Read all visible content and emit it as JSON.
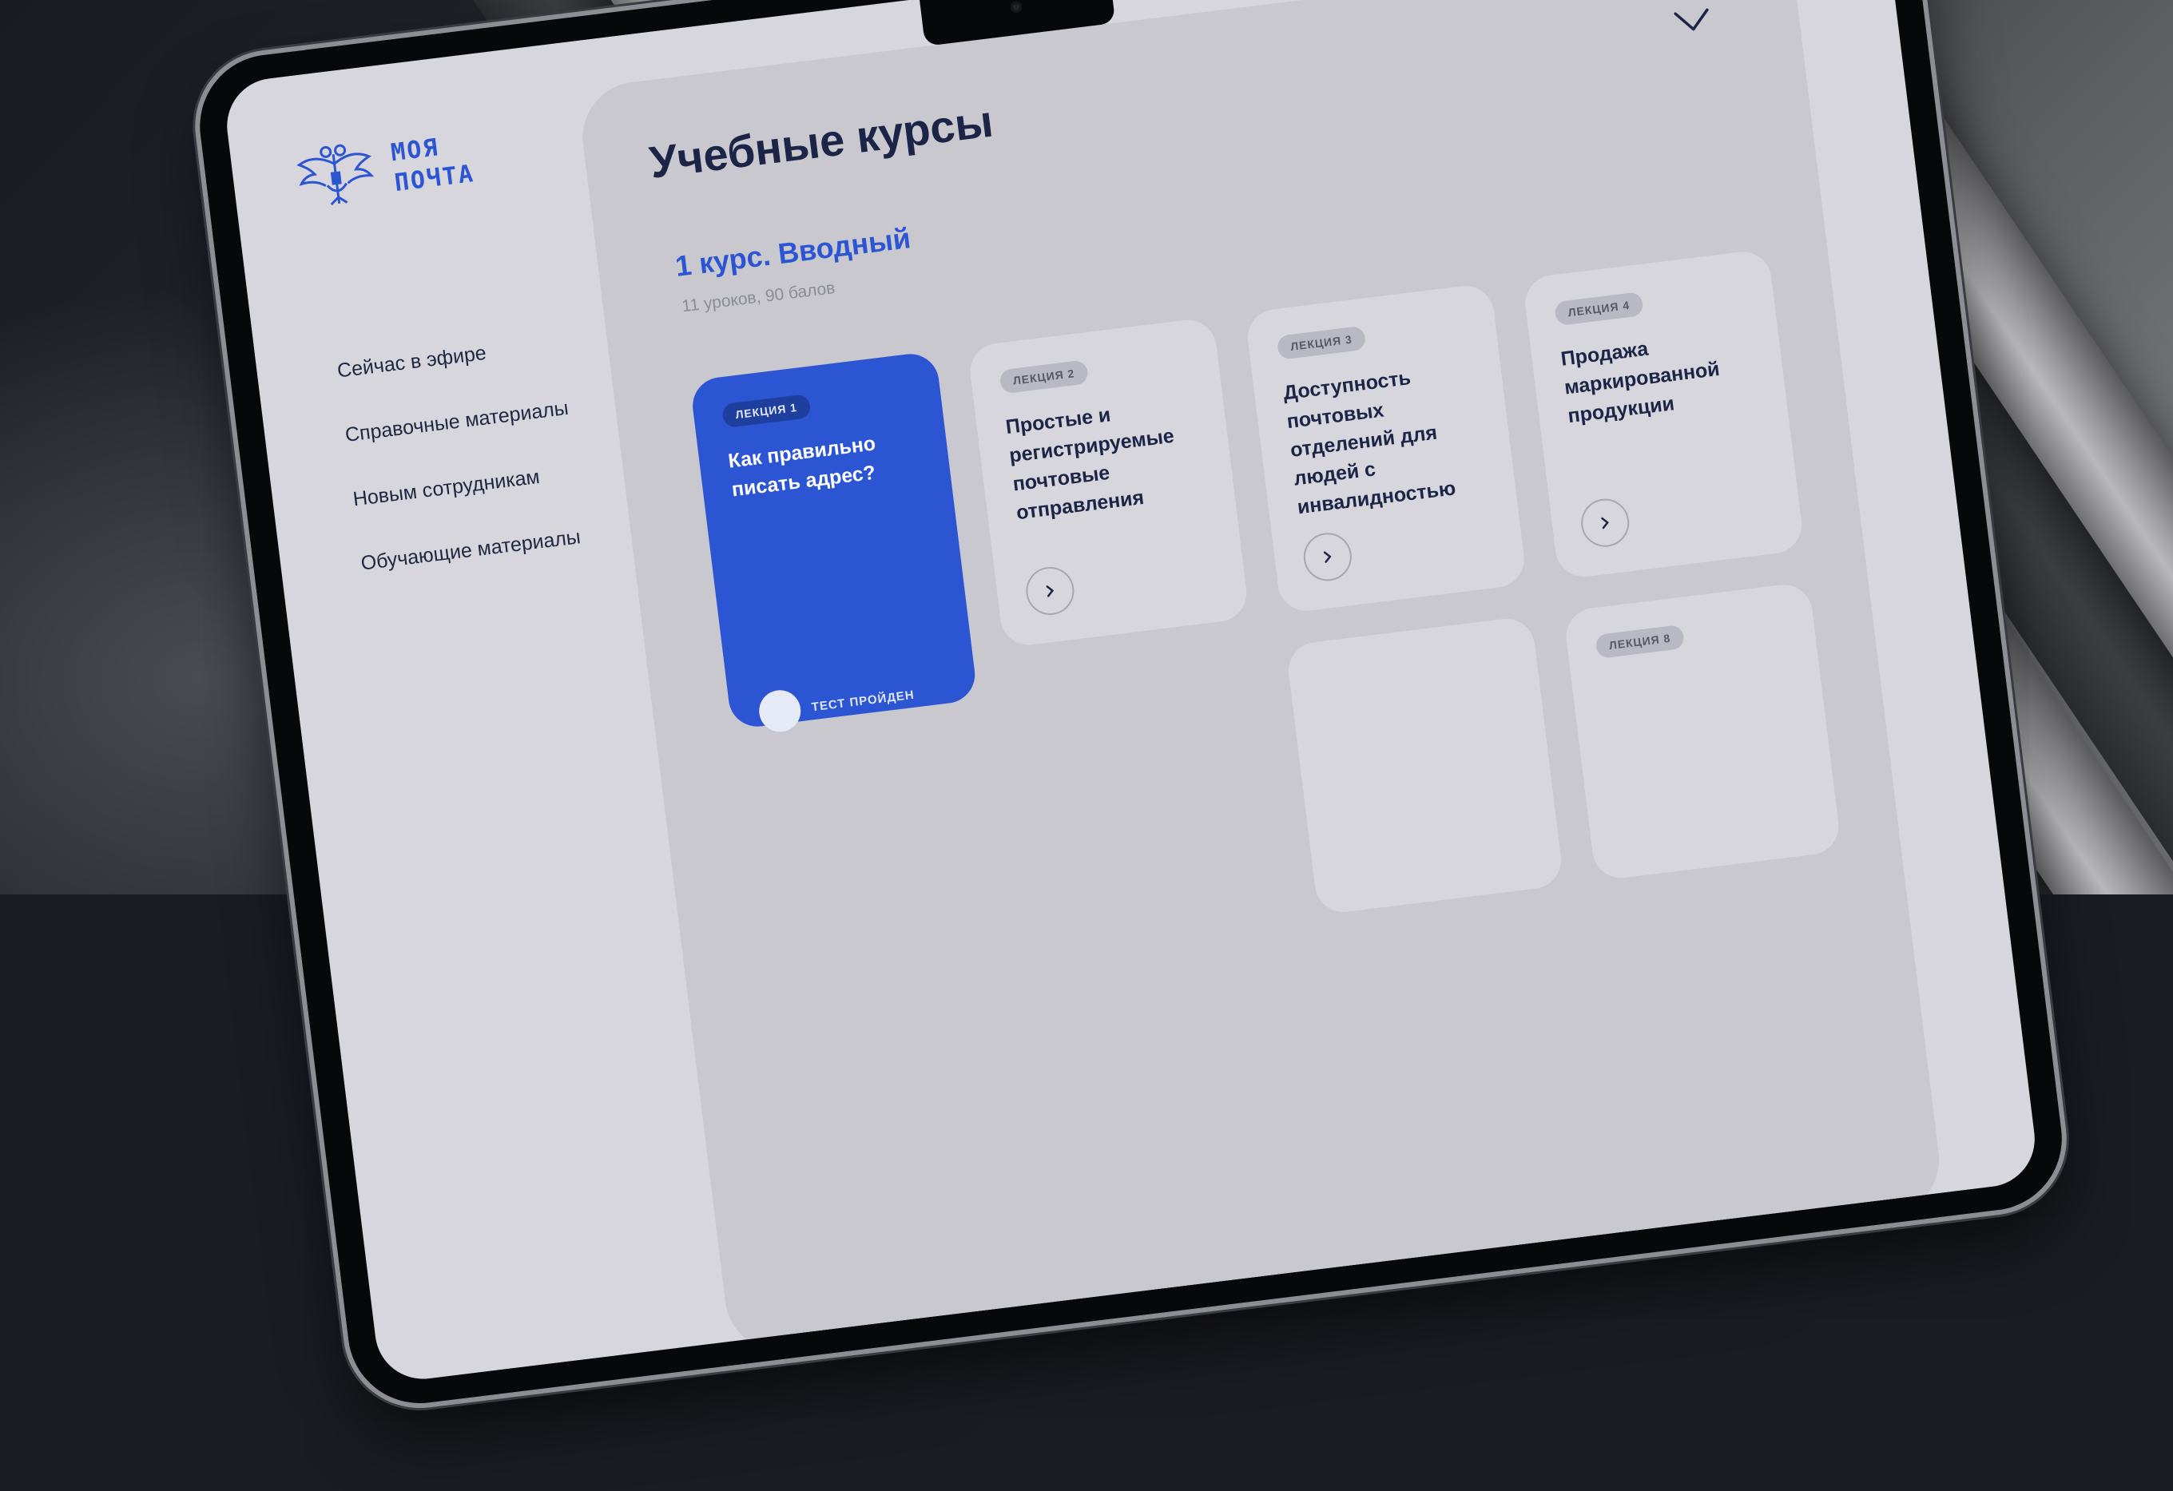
{
  "brand": {
    "line1": "МОЯ",
    "line2": "ПОЧТА"
  },
  "sidebar": {
    "items": [
      {
        "label": "Сейчас в эфире"
      },
      {
        "label": "Справочные материалы"
      },
      {
        "label": "Новым сотрудникам"
      },
      {
        "label": "Обучающие материалы"
      }
    ]
  },
  "main": {
    "title": "Учебные курсы",
    "course": {
      "title": "1 курс. Вводный",
      "meta": "11 уроков, 90 балов"
    },
    "lectures": [
      {
        "badge": "ЛЕКЦИЯ 1",
        "title": "Как правильно писать адрес?",
        "status": "ТЕСТ ПРОЙДЕН"
      },
      {
        "badge": "ЛЕКЦИЯ 2",
        "title": "Простые и регистрируемые почтовые отправления"
      },
      {
        "badge": "ЛЕКЦИЯ 3",
        "title": "Доступность почтовых отделений для людей с инвалидностью"
      },
      {
        "badge": "ЛЕКЦИЯ 4",
        "title": "Продажа маркированной продукции"
      },
      {
        "badge": "ЛЕКЦИЯ 8",
        "title": ""
      }
    ]
  },
  "colors": {
    "accent": "#2c55d3",
    "heading": "#1c2547",
    "panel": "#c8c8ce",
    "screen": "#d6d6dc"
  }
}
